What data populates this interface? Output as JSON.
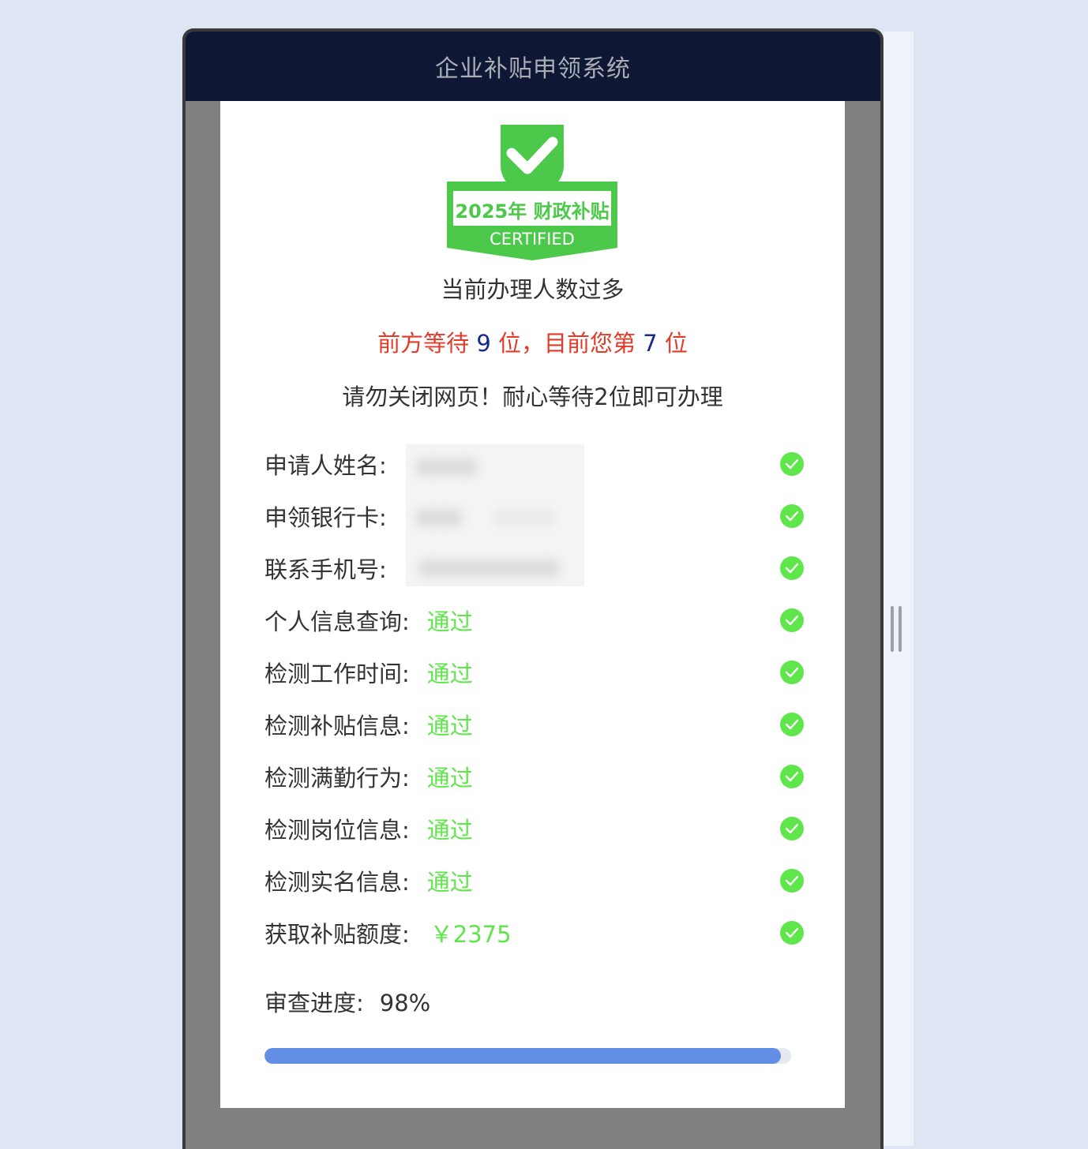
{
  "app": {
    "title": "企业补贴申领系统"
  },
  "badge": {
    "year_text": "2025年 财政补贴",
    "certified_text": "CERTIFIED",
    "color": "#4cc84a"
  },
  "status": {
    "headline": "当前办理人数过多",
    "queue_prefix": "前方等待",
    "queue_ahead": "9",
    "queue_mid": "位，目前您第",
    "queue_position": "7",
    "queue_suffix": "位",
    "notice": "请勿关闭网页！耐心等待2位即可办理"
  },
  "fields": [
    {
      "label": "申请人姓名:",
      "value": "",
      "status_icon": "check-circle-icon"
    },
    {
      "label": "申领银行卡:",
      "value": "",
      "status_icon": "check-circle-icon"
    },
    {
      "label": "联系手机号:",
      "value": "",
      "status_icon": "check-circle-icon"
    },
    {
      "label": "个人信息查询:",
      "value": "通过",
      "status_icon": "check-circle-icon"
    },
    {
      "label": "检测工作时间:",
      "value": "通过",
      "status_icon": "check-circle-icon"
    },
    {
      "label": "检测补贴信息:",
      "value": "通过",
      "status_icon": "check-circle-icon"
    },
    {
      "label": "检测满勤行为:",
      "value": "通过",
      "status_icon": "check-circle-icon"
    },
    {
      "label": "检测岗位信息:",
      "value": "通过",
      "status_icon": "check-circle-icon"
    },
    {
      "label": "检测实名信息:",
      "value": "通过",
      "status_icon": "check-circle-icon"
    },
    {
      "label": "获取补贴额度:",
      "value": "￥2375",
      "status_icon": "check-circle-icon"
    }
  ],
  "progress": {
    "label": "审查进度:",
    "value_text": "98%",
    "fraction": 0.98,
    "color": "#628fe3"
  },
  "colors": {
    "pass": "#5ee64a",
    "alert": "#e23b2a",
    "number": "#1a2a8a",
    "header": "#0e1733"
  }
}
